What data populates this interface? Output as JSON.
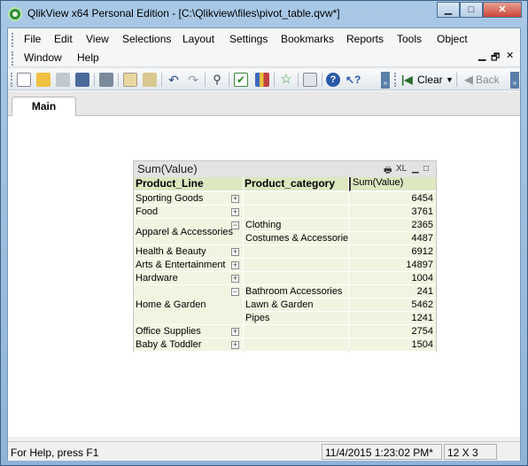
{
  "window": {
    "title": "QlikView x64 Personal Edition - [C:\\Qlikview\\files\\pivot_table.qvw*]",
    "minimize_glyph": "▁",
    "maximize_glyph": "□",
    "close_glyph": "✕"
  },
  "menu": [
    "File",
    "Edit",
    "View",
    "Selections",
    "Layout",
    "Settings",
    "Bookmarks",
    "Reports",
    "Tools",
    "Object",
    "Window",
    "Help"
  ],
  "menu_right_glyphs": {
    "minimize": "▁",
    "restore": "🗗",
    "close": "✕"
  },
  "toolbar": {
    "clear_label": "Clear",
    "back_label": "Back",
    "icons": [
      "new-icon",
      "open-icon",
      "reload-icon",
      "save-icon",
      "print-icon",
      "edit-script-icon",
      "reload-data-icon",
      "undo-icon",
      "redo-icon",
      "search-icon",
      "check-icon",
      "chart-icon",
      "bookmark-star-icon",
      "properties-icon",
      "help-icon",
      "help-pointer-icon"
    ]
  },
  "tabs": [
    {
      "label": "Main"
    }
  ],
  "pivot": {
    "title": "Sum(Value)",
    "caption_glyphs": {
      "print": "🖶",
      "xl": "XL",
      "minimize": "▁",
      "maximize": "□"
    },
    "headers": [
      "Product_Line",
      "Product_category",
      "Sum(Value)"
    ],
    "rows": [
      {
        "line": "Sporting Goods",
        "toggle": "+",
        "category": "",
        "value": "6454"
      },
      {
        "line": "Food",
        "toggle": "+",
        "category": "",
        "value": "3761"
      },
      {
        "line": "Apparel & Accessories",
        "toggle": "−",
        "category": "Clothing",
        "value": "2365"
      },
      {
        "line": "",
        "toggle": "",
        "category": "Costumes & Accessories",
        "value": "4487"
      },
      {
        "line": "Health & Beauty",
        "toggle": "+",
        "category": "",
        "value": "6912"
      },
      {
        "line": "Arts & Entertainment",
        "toggle": "+",
        "category": "",
        "value": "14897"
      },
      {
        "line": "Hardware",
        "toggle": "+",
        "category": "",
        "value": "1004"
      },
      {
        "line": "Home & Garden",
        "toggle": "−",
        "category": "Bathroom Accessories",
        "value": "241"
      },
      {
        "line": "",
        "toggle": "",
        "category": "Lawn & Garden",
        "value": "5462"
      },
      {
        "line": "",
        "toggle": "",
        "category": "Pipes",
        "value": "1241"
      },
      {
        "line": "Office Supplies",
        "toggle": "+",
        "category": "",
        "value": "2754"
      },
      {
        "line": "Baby & Toddler",
        "toggle": "+",
        "category": "",
        "value": "1504"
      }
    ]
  },
  "status": {
    "help_text": "For Help, press F1",
    "timestamp": "11/4/2015 1:23:02 PM*",
    "dimensions": "12 X 3"
  },
  "colors": {
    "header_bg": "#dde7c0",
    "cell_bg": "#f0f5e1",
    "frame": "#8fb4d8"
  }
}
